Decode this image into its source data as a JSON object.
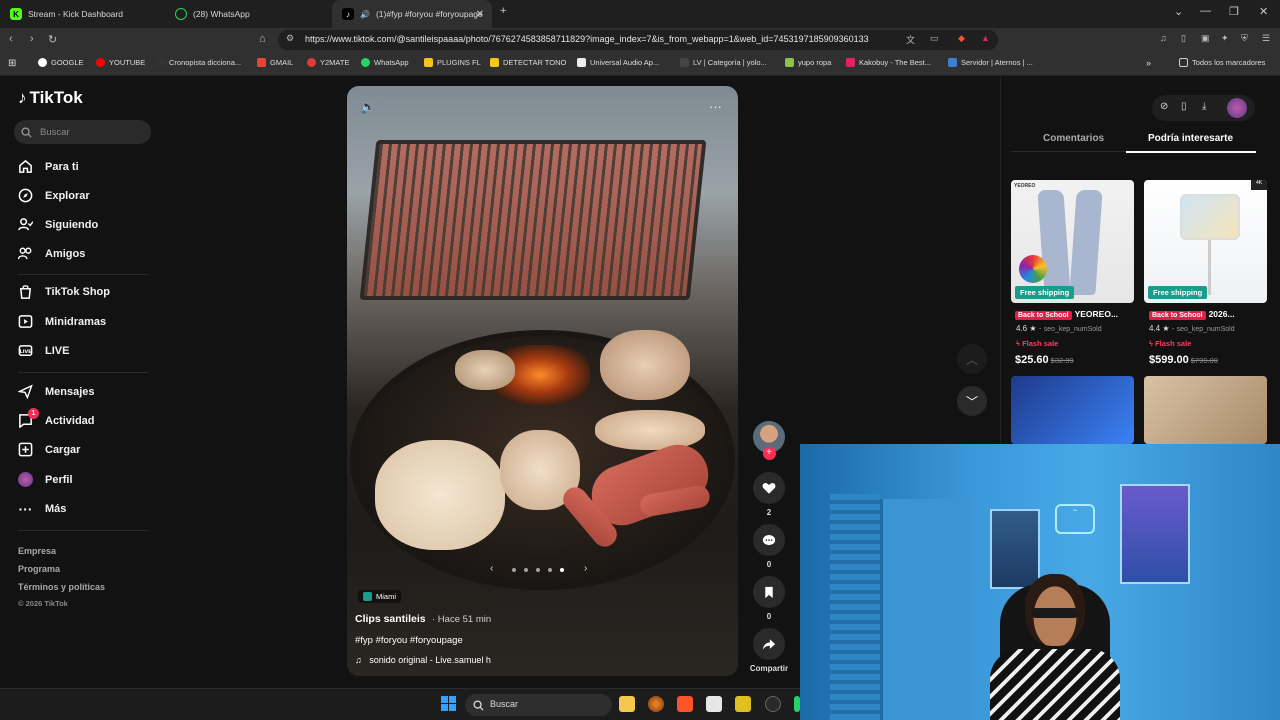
{
  "browser": {
    "tabs": [
      {
        "label": "Stream - Kick Dashboard",
        "icon": "kick-icon"
      },
      {
        "label": "(28) WhatsApp",
        "icon": "whatsapp-icon"
      },
      {
        "label": "(1)#fyp #foryou #foryoupage",
        "icon": "tiktok-icon",
        "active": true
      }
    ],
    "url": "https://www.tiktok.com/@santileispaaaa/photo/7676274583858711829?image_index=7&is_from_webapp=1&web_id=7453197185909360133",
    "bookmarks": [
      "GOOGLE",
      "YOUTUBE",
      "Cronopista dicciona...",
      "GMAIL",
      "Y2MATE",
      "WhatsApp",
      "PLUGINS FL",
      "DETECTAR TONO",
      "Universal Audio Ap...",
      "LV | Categoría | yolo...",
      "yupo ropa",
      "Kakobuy - The Best...",
      "Servidor | Aternos | ..."
    ],
    "bookmarks_folder": "Todos los marcadores"
  },
  "tiktok": {
    "logo": "TikTok",
    "search_placeholder": "Buscar",
    "nav": [
      {
        "label": "Para ti",
        "icon": "home-icon"
      },
      {
        "label": "Explorar",
        "icon": "compass-icon"
      },
      {
        "label": "Siguiendo",
        "icon": "following-icon"
      },
      {
        "label": "Amigos",
        "icon": "friends-icon"
      },
      {
        "label": "TikTok Shop",
        "icon": "shop-icon"
      },
      {
        "label": "Minidramas",
        "icon": "drama-icon"
      },
      {
        "label": "LIVE",
        "icon": "live-icon"
      },
      {
        "label": "Mensajes",
        "icon": "messages-icon"
      },
      {
        "label": "Actividad",
        "icon": "activity-icon",
        "badge": "1"
      },
      {
        "label": "Cargar",
        "icon": "upload-icon"
      },
      {
        "label": "Perfil",
        "icon": "avatar"
      },
      {
        "label": "Más",
        "icon": "more-icon"
      }
    ],
    "footer": [
      "Empresa",
      "Programa",
      "Términos y políticas",
      "© 2026 TikTok"
    ],
    "post": {
      "location": "Miami",
      "user": "Clips santileis",
      "time": "· Hace 51 min",
      "tags": "#fyp #foryou #foryoupage",
      "sound": "sonido original - Live.samuel h",
      "likes": "2",
      "comments": "0",
      "saves": "0",
      "share_label": "Compartir"
    },
    "right_tabs": [
      "Comentarios",
      "Podría interesarte"
    ],
    "products": [
      {
        "badge": "Back to School",
        "title": "YEOREO...",
        "rating": "4.6",
        "sold": "seo_kep_numSold",
        "flash": "Flash sale",
        "price": "$25.60",
        "old_price": "$32.99",
        "shipping": "Free shipping",
        "brand": "YEOREO"
      },
      {
        "badge": "Back to School",
        "title": "2026...",
        "rating": "4.4",
        "sold": "seo_kep_numSold",
        "flash": "Flash sale",
        "price": "$599.00",
        "old_price": "$799.00",
        "shipping": "Free shipping"
      }
    ]
  },
  "taskbar": {
    "search": "Buscar"
  },
  "colors": {
    "accent": "#fe2c55",
    "teal": "#1a9d8a",
    "background": "#121212"
  }
}
